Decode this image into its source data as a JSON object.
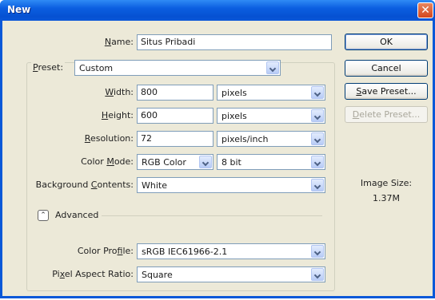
{
  "window": {
    "title": "New",
    "close_glyph": "✕"
  },
  "name": {
    "label_u": "N",
    "label_rest": "ame:",
    "value": "Situs Pribadi"
  },
  "preset": {
    "label_u": "P",
    "label_rest": "reset:",
    "value": "Custom"
  },
  "width": {
    "label_u": "W",
    "label_rest": "idth:",
    "value": "800",
    "unit": "pixels"
  },
  "height": {
    "label_u": "H",
    "label_rest": "eight:",
    "value": "600",
    "unit": "pixels"
  },
  "resolution": {
    "label_u": "R",
    "label_rest": "esolution:",
    "value": "72",
    "unit": "pixels/inch"
  },
  "color_mode": {
    "label_pre": "Color ",
    "label_u": "M",
    "label_rest": "ode:",
    "value": "RGB Color",
    "depth": "8 bit"
  },
  "background": {
    "label_pre": "Background ",
    "label_u": "C",
    "label_rest": "ontents:",
    "value": "White"
  },
  "advanced": {
    "label": "Advanced",
    "icon_glyph": "⌃"
  },
  "color_profile": {
    "label_pre": "Color Pro",
    "label_u": "f",
    "label_rest": "ile:",
    "value": "sRGB IEC61966-2.1"
  },
  "pixel_aspect": {
    "label_pre": "Pi",
    "label_u": "x",
    "label_rest": "el Aspect Ratio:",
    "value": "Square"
  },
  "buttons": {
    "ok": "OK",
    "cancel": "Cancel",
    "save_preset_u": "S",
    "save_preset_rest": "ave Preset...",
    "delete_preset_u": "D",
    "delete_preset_rest": "elete Preset..."
  },
  "image_size": {
    "label": "Image Size:",
    "value": "1.37M"
  },
  "colors": {
    "title_bar": "#0b5ee0",
    "dialog_bg": "#ece9d8",
    "field_border": "#7f9db9"
  },
  "icons": {
    "close": "close-icon",
    "dropdown": "chevron-down-icon",
    "advanced": "collapse-icon"
  }
}
